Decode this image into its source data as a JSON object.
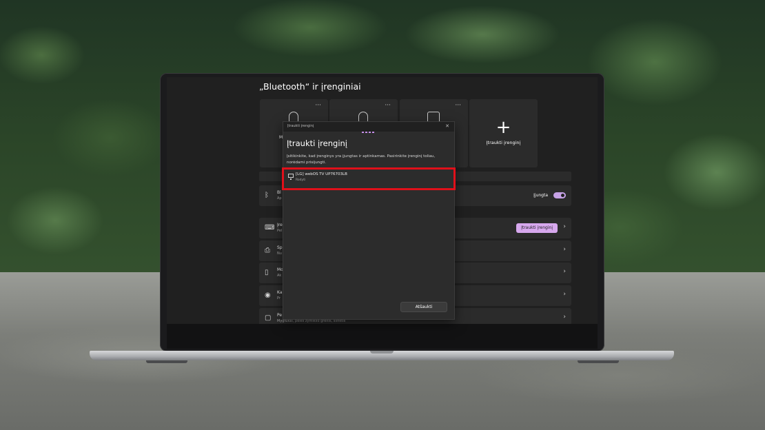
{
  "settings": {
    "page_title": "„Bluetooth“ ir įrenginiai",
    "device_cards": [
      {
        "label": "M",
        "more": "···",
        "icon": "mouse-icon"
      },
      {
        "label": "",
        "more": "···",
        "icon": "mouse-icon"
      },
      {
        "label": "",
        "more": "···",
        "icon": "camera-icon"
      }
    ],
    "add_card": {
      "plus": "+",
      "label": "Įtraukti įrenginį"
    },
    "rows": [
      {
        "id": "bluetooth",
        "icon": "bluetooth-icon",
        "title": "Bl",
        "sub": "Ap",
        "toggle_label": "Įjungta",
        "toggle_on": true
      },
      {
        "id": "devices",
        "icon": "devices-icon",
        "title": "Įre",
        "sub": "Pel",
        "button_label": "Įtraukti įrenginį"
      },
      {
        "id": "printers",
        "icon": "printer-icon",
        "title": "Sp",
        "sub": "Nu"
      },
      {
        "id": "phone",
        "icon": "phone-icon",
        "title": "Mo",
        "sub": "Ak"
      },
      {
        "id": "cameras",
        "icon": "camera-icon",
        "title": "Ka",
        "sub": "Pr"
      },
      {
        "id": "mouse",
        "icon": "mouse-icon",
        "title": "Pe",
        "sub": "Mygtukai, pelės žymiklio greitis, slinktis"
      }
    ],
    "chevron": "›"
  },
  "dialog": {
    "titlebar": "Įtraukti įrenginį",
    "close": "✕",
    "heading": "Įtraukti įrenginį",
    "description": "Įsitikinkite, kad įrenginys yra įjungtas ir aptinkamas. Pasirinkite įrenginį toliau, norėdami prisijungti.",
    "devices": [
      {
        "name": "[LG] webOS TV UP76703LB",
        "type": "Rodyti",
        "icon": "monitor-icon"
      }
    ],
    "cancel_label": "Atšaukti"
  }
}
